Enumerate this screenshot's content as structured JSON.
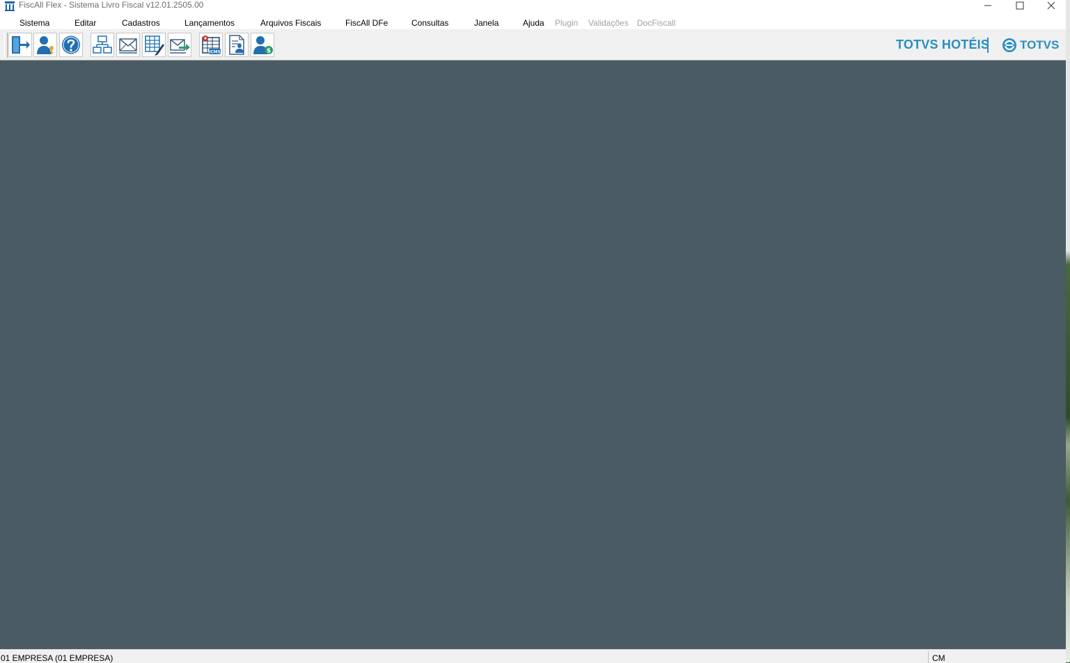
{
  "window": {
    "title": "FiscAll Flex - Sistema Livro Fiscal v12.01.2505.00",
    "icon": "building-columns-icon",
    "controls": [
      "minimize-icon",
      "maximize-icon",
      "close-icon"
    ]
  },
  "menu": {
    "items": [
      {
        "label": "Sistema",
        "enabled": true
      },
      {
        "label": "Editar",
        "enabled": true
      },
      {
        "label": "Cadastros",
        "enabled": true
      },
      {
        "label": "Lançamentos",
        "enabled": true
      },
      {
        "label": "Arquivos Fiscais",
        "enabled": true
      },
      {
        "label": "FiscAll DFe",
        "enabled": true
      },
      {
        "label": "Consultas",
        "enabled": true
      },
      {
        "label": "Janela",
        "enabled": true
      },
      {
        "label": "Ajuda",
        "enabled": true
      },
      {
        "label": "Plugin",
        "enabled": false
      },
      {
        "label": "Validações",
        "enabled": false
      },
      {
        "label": "DocFiscall",
        "enabled": false
      }
    ]
  },
  "toolbar": {
    "buttons": [
      {
        "icon": "exit-door-icon"
      },
      {
        "icon": "user-key-icon"
      },
      {
        "icon": "help-question-icon"
      },
      {
        "icon": "org-chart-icon"
      },
      {
        "icon": "envelope-icon"
      },
      {
        "icon": "grid-edit-icon"
      },
      {
        "icon": "send-mail-icon"
      },
      {
        "icon": "icms-table-icon",
        "badge": "ICMS"
      },
      {
        "icon": "document-user-icon"
      },
      {
        "icon": "user-money-icon",
        "badge": "$"
      }
    ]
  },
  "brand": {
    "hoteis": "TOTVS HOTÉIS",
    "totvs": "TOTVS",
    "color": "#2a8fbf"
  },
  "workspace": {
    "color": "#4a5b63"
  },
  "status": {
    "company": "01 EMPRESA (01 EMPRESA)",
    "mode": "CM"
  }
}
